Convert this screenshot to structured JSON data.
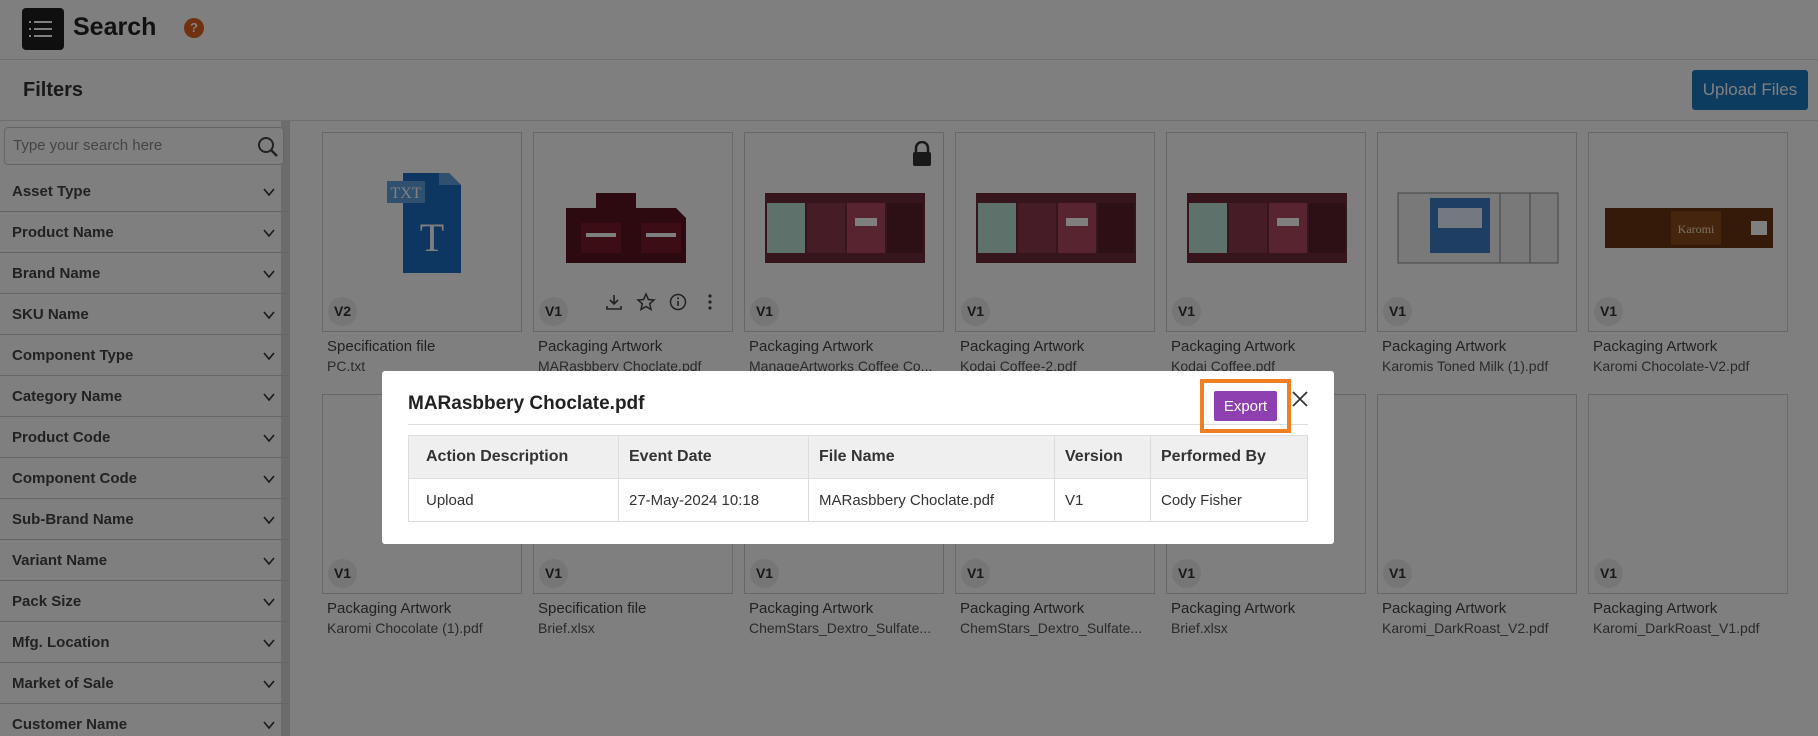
{
  "header": {
    "title": "Search",
    "help_icon": "question-circle-icon",
    "help_glyph": "?"
  },
  "filterbar": {
    "title": "Filters",
    "upload_label": "Upload Files"
  },
  "sidebar": {
    "search_placeholder": "Type your search here",
    "filters": [
      "Asset Type",
      "Product Name",
      "Brand Name",
      "SKU Name",
      "Component Type",
      "Category Name",
      "Product Code",
      "Component Code",
      "Sub-Brand Name",
      "Variant Name",
      "Pack Size",
      "Mfg. Location",
      "Market of Sale",
      "Customer Name"
    ]
  },
  "cards_row1": [
    {
      "version": "V2",
      "title": "Specification file",
      "file": "PC.txt",
      "thumb": "txt-file-icon"
    },
    {
      "version": "V1",
      "title": "Packaging Artwork",
      "file": "MARasbbery Choclate.pdf",
      "thumb": "box-dieline"
    },
    {
      "version": "V1",
      "title": "Packaging Artwork",
      "file": "ManageArtworks Coffee Co...",
      "thumb": "coffee-dieline",
      "locked": true
    },
    {
      "version": "V1",
      "title": "Packaging Artwork",
      "file": "Kodai Coffee-2.pdf",
      "thumb": "coffee-dieline"
    },
    {
      "version": "V1",
      "title": "Packaging Artwork",
      "file": "Kodai Coffee.pdf",
      "thumb": "coffee-dieline"
    },
    {
      "version": "V1",
      "title": "Packaging Artwork",
      "file": "Karomis Toned Milk (1).pdf",
      "thumb": "milk-dieline"
    },
    {
      "version": "V1",
      "title": "Packaging Artwork",
      "file": "Karomi Chocolate-V2.pdf",
      "thumb": "chocolate-wrapper"
    }
  ],
  "cards_row2": [
    {
      "version": "V1",
      "title": "Packaging Artwork",
      "file": "Karomi Chocolate (1).pdf"
    },
    {
      "version": "V1",
      "title": "Specification file",
      "file": "Brief.xlsx"
    },
    {
      "version": "V1",
      "title": "Packaging Artwork",
      "file": "ChemStars_Dextro_Sulfate..."
    },
    {
      "version": "V1",
      "title": "Packaging Artwork",
      "file": "ChemStars_Dextro_Sulfate..."
    },
    {
      "version": "V1",
      "title": "Packaging Artwork",
      "file": "Brief.xlsx"
    },
    {
      "version": "V1",
      "title": "Packaging Artwork",
      "file": "Karomi_DarkRoast_V2.pdf"
    },
    {
      "version": "V1",
      "title": "Packaging Artwork",
      "file": "Karomi_DarkRoast_V1.pdf"
    }
  ],
  "modal": {
    "title": "MARasbbery Choclate.pdf",
    "export_label": "Export",
    "close_icon": "close-icon",
    "columns": [
      "Action Description",
      "Event Date",
      "File Name",
      "Version",
      "Performed By"
    ],
    "rows": [
      [
        "Upload",
        "27-May-2024 10:18",
        "MARasbbery Choclate.pdf",
        "V1",
        "Cody Fisher"
      ]
    ]
  },
  "colors": {
    "accent": "#1a78c2",
    "export": "#8e3fb0",
    "highlight": "#f07f23",
    "help": "#e0631f"
  }
}
